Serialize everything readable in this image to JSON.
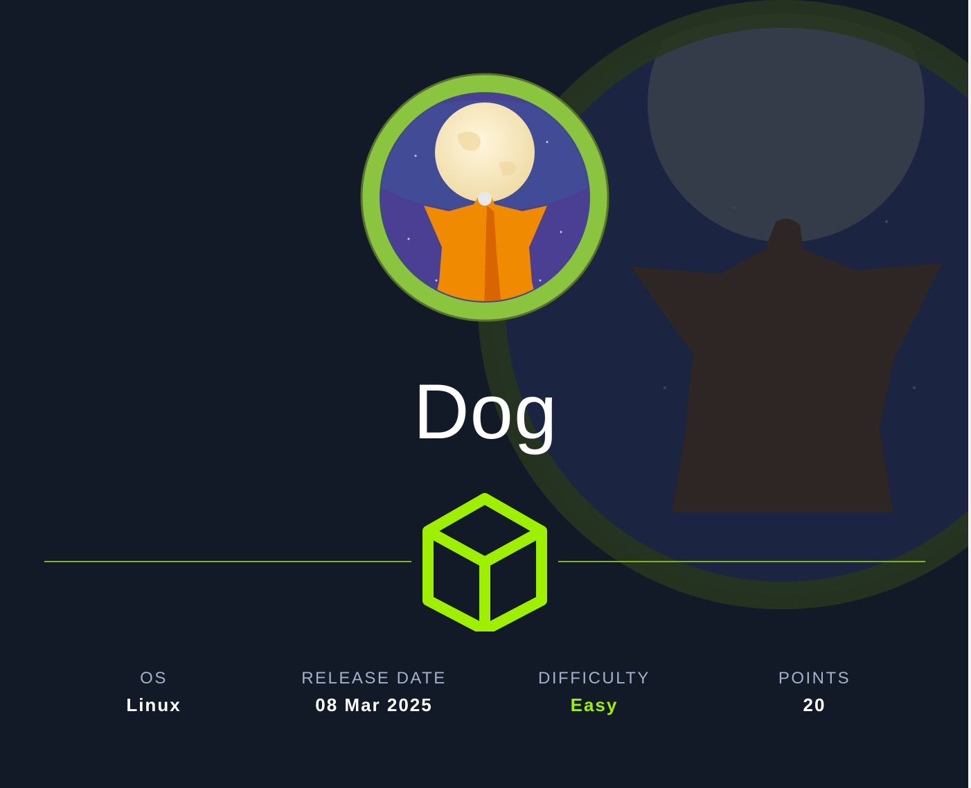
{
  "machine": {
    "name": "Dog"
  },
  "stats": [
    {
      "label": "OS",
      "value": "Linux"
    },
    {
      "label": "RELEASE DATE",
      "value": "08 Mar 2025"
    },
    {
      "label": "DIFFICULTY",
      "value": "Easy"
    },
    {
      "label": "POINTS",
      "value": "20"
    }
  ],
  "colors": {
    "background": "#131a27",
    "accent_green": "#9fef00",
    "ring_green": "#86c440",
    "label": "#a4b1cd"
  },
  "icons": {
    "platform_logo": "cube-icon",
    "machine_avatar": "dog-moon-avatar"
  }
}
